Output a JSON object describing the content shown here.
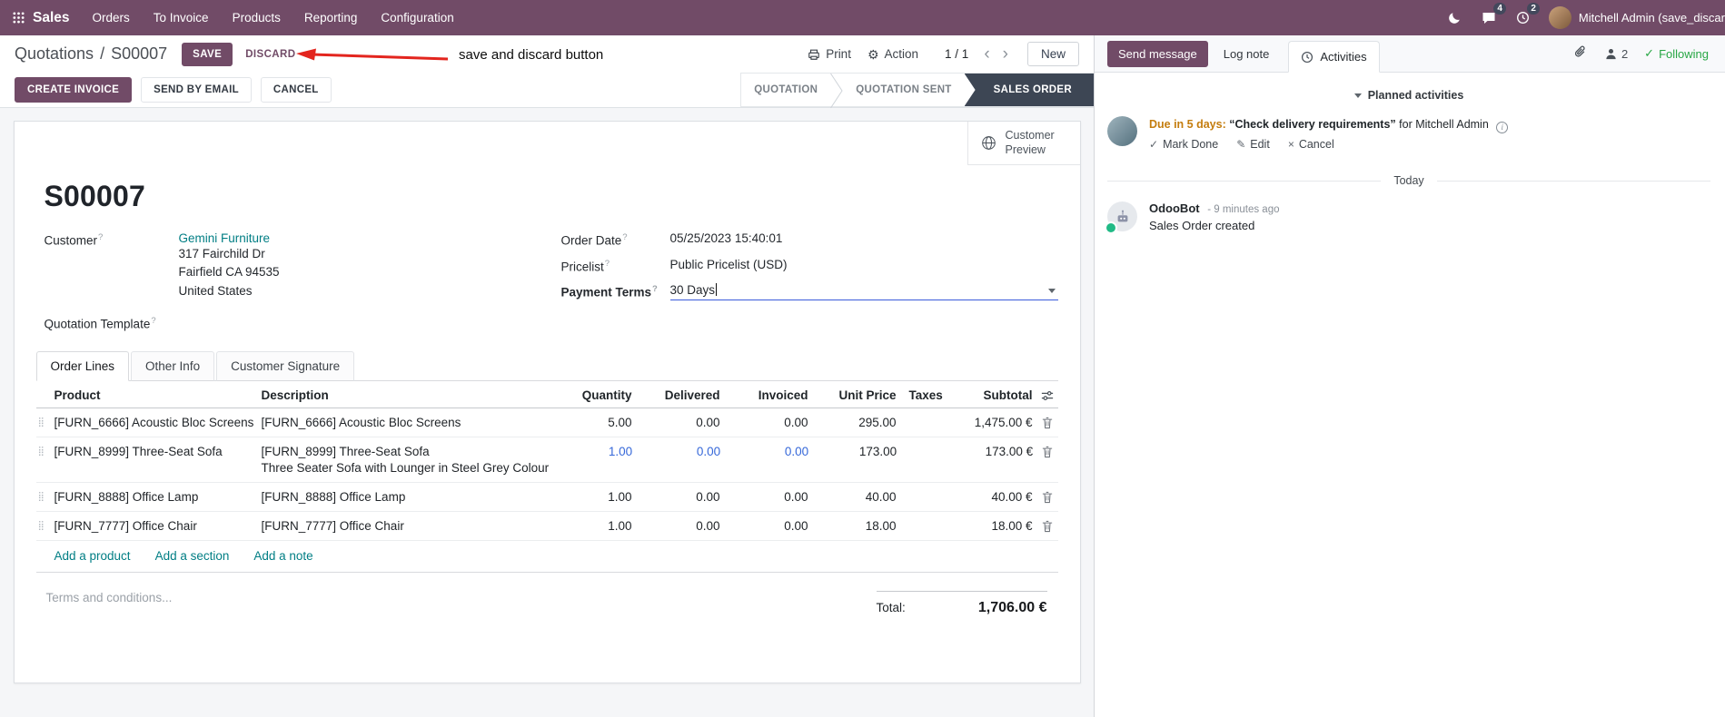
{
  "nav": {
    "brand": "Sales",
    "items": [
      "Orders",
      "To Invoice",
      "Products",
      "Reporting",
      "Configuration"
    ],
    "chat_badge": "4",
    "clock_badge": "2",
    "user_name": "Mitchell Admin (save_discar"
  },
  "icons": {
    "gear": "⚙",
    "check": "✓",
    "pencil": "✎",
    "cross": "×",
    "drag_handle": "⣿",
    "info": "i",
    "prev": "‹",
    "next": "›"
  },
  "control": {
    "breadcrumb_parent": "Quotations",
    "breadcrumb_sep": "/",
    "record_name": "S00007",
    "save_label": "SAVE",
    "discard_label": "DISCARD",
    "annotation": "save and discard button",
    "print_label": "Print",
    "action_label": "Action",
    "pager": "1 / 1",
    "new_label": "New"
  },
  "statusbar": {
    "create_invoice": "CREATE INVOICE",
    "send_by_email": "SEND BY EMAIL",
    "cancel": "CANCEL",
    "stages": [
      "QUOTATION",
      "QUOTATION SENT",
      "SALES ORDER"
    ],
    "active_stage": "SALES ORDER"
  },
  "sheet": {
    "customer_preview": "Customer Preview",
    "title": "S00007",
    "help_marker": "?",
    "customer_label": "Customer",
    "customer_name": "Gemini Furniture",
    "address_line1": "317 Fairchild Dr",
    "address_line2": "Fairfield CA 94535",
    "address_line3": "United States",
    "quotation_template_label": "Quotation Template",
    "order_date_label": "Order Date",
    "order_date_value": "05/25/2023 15:40:01",
    "pricelist_label": "Pricelist",
    "pricelist_value": "Public Pricelist (USD)",
    "payment_terms_label": "Payment Terms",
    "payment_terms_value": "30 Days"
  },
  "tabs": [
    "Order Lines",
    "Other Info",
    "Customer Signature"
  ],
  "order_lines": {
    "headers": {
      "product": "Product",
      "description": "Description",
      "quantity": "Quantity",
      "delivered": "Delivered",
      "invoiced": "Invoiced",
      "unit_price": "Unit Price",
      "taxes": "Taxes",
      "subtotal": "Subtotal"
    },
    "rows": [
      {
        "product": "[FURN_6666] Acoustic Bloc Screens",
        "description": "[FURN_6666] Acoustic Bloc Screens",
        "description2": "",
        "quantity": "5.00",
        "delivered": "0.00",
        "invoiced": "0.00",
        "unit_price": "295.00",
        "subtotal": "1,475.00 €"
      },
      {
        "product": "[FURN_8999] Three-Seat Sofa",
        "description": "[FURN_8999] Three-Seat Sofa",
        "description2": "Three Seater Sofa with Lounger in Steel Grey Colour",
        "quantity": "1.00",
        "delivered": "0.00",
        "invoiced": "0.00",
        "unit_price": "173.00",
        "subtotal": "173.00 €"
      },
      {
        "product": "[FURN_8888] Office Lamp",
        "description": "[FURN_8888] Office Lamp",
        "description2": "",
        "quantity": "1.00",
        "delivered": "0.00",
        "invoiced": "0.00",
        "unit_price": "40.00",
        "subtotal": "40.00 €"
      },
      {
        "product": "[FURN_7777] Office Chair",
        "description": "[FURN_7777] Office Chair",
        "description2": "",
        "quantity": "1.00",
        "delivered": "0.00",
        "invoiced": "0.00",
        "unit_price": "18.00",
        "subtotal": "18.00 €"
      }
    ],
    "add_product": "Add a product",
    "add_section": "Add a section",
    "add_note": "Add a note",
    "terms_placeholder": "Terms and conditions...",
    "total_label": "Total:",
    "total_value": "1,706.00 €"
  },
  "chatter": {
    "send_message": "Send message",
    "log_note": "Log note",
    "activities_tab": "Activities",
    "followers_count": "2",
    "following": "Following",
    "planned_activities": "Planned activities",
    "activity": {
      "due": "Due in 5 days:",
      "summary": "“Check delivery requirements”",
      "assignee": "for Mitchell Admin",
      "mark_done": "Mark Done",
      "edit": "Edit",
      "cancel": "Cancel"
    },
    "today_divider": "Today",
    "message": {
      "author": "OdooBot",
      "time": "- 9 minutes ago",
      "body": "Sales Order created"
    }
  },
  "colors": {
    "brand": "#714B67",
    "link": "#017e84",
    "modified_field": "#3668d9",
    "warning": "#c47d0e",
    "success": "#28a745",
    "stage_active_bg": "#3d4654",
    "annotation_red": "#e3251e"
  }
}
